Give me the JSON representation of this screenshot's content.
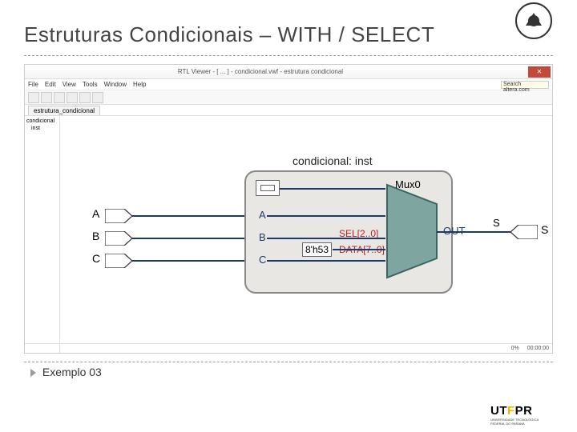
{
  "slide": {
    "title": "Estruturas Condicionais – WITH / SELECT",
    "footer": "Exemplo 03"
  },
  "window": {
    "title": "RTL Viewer - [ ... ] - condicional.vwf - estrutura condicional",
    "menus": [
      "File",
      "Edit",
      "View",
      "Tools",
      "Window",
      "Help"
    ],
    "search_placeholder": "Search altera.com",
    "tab": "estrutura_condicional",
    "tree": [
      "condicional",
      "inst"
    ],
    "status_left": "0%",
    "status_right": "00:00:00"
  },
  "diagram": {
    "block_title": "condicional: inst",
    "mux_label": "Mux0",
    "inputs": {
      "A": "A",
      "B": "B",
      "C": "C"
    },
    "block_ports": {
      "A": "A",
      "B": "B",
      "C": "C",
      "sel": "SEL[2..0]",
      "data": "DATA[7..0]",
      "out": "OUT"
    },
    "data_constant": "8'h53",
    "output": {
      "S_wire": "S",
      "S_pin": "S"
    }
  },
  "logos": {
    "utfpr": "UTFPR",
    "utfpr_sub": "UNIVERSIDADE TECNOLÓGICA FEDERAL DO PARANÁ"
  }
}
